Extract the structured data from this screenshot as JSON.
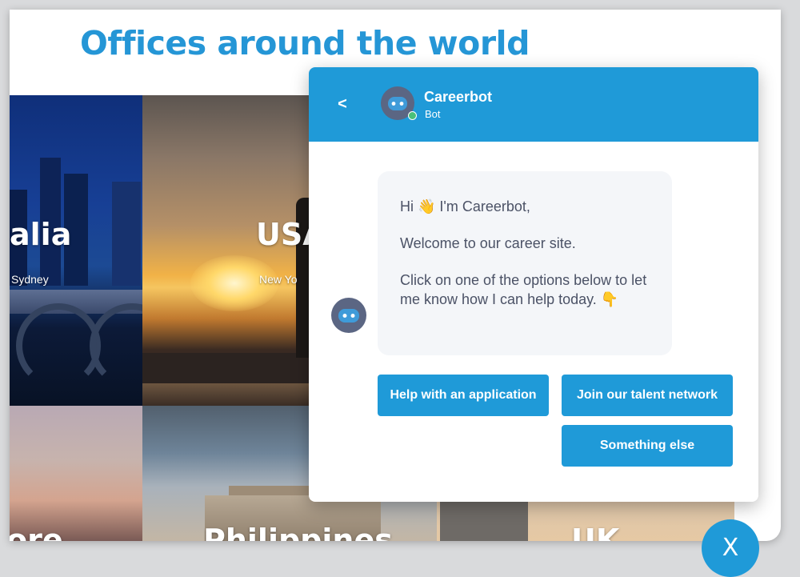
{
  "page": {
    "title": "Offices around the world",
    "tiles": [
      {
        "name": "alia",
        "city": "Sydney"
      },
      {
        "name": "USA",
        "city": "New Yo"
      },
      {
        "name": "ore",
        "city": ""
      },
      {
        "name": "Philippines",
        "city": ""
      },
      {
        "name": "UK",
        "city": ""
      }
    ]
  },
  "chat": {
    "back_label": "<",
    "bot_name": "Careerbot",
    "bot_role": "Bot",
    "status_color": "#4ac07a",
    "accent_color": "#1f9ad8",
    "message": {
      "greeting": "Hi 👋 I'm Careerbot,",
      "line2": "Welcome to our career site.",
      "line3": "Click on one of the options below to let me know how I can help today. 👇"
    },
    "options": [
      "Help with an application",
      "Join our talent network",
      "Something else"
    ]
  },
  "close_label": "X"
}
